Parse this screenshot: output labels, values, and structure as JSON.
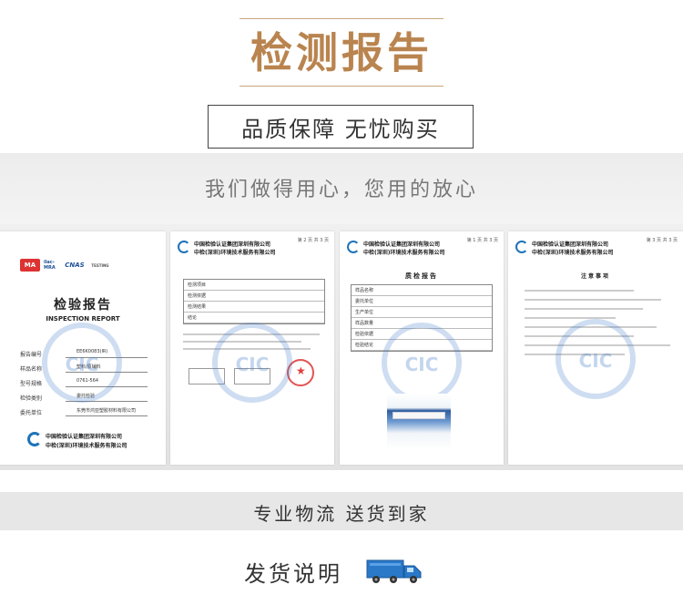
{
  "hero": {
    "title": "检测报告",
    "subtitle": "品质保障 无忧购买"
  },
  "slogan": "我们做得用心，您用的放心",
  "documents": {
    "doc1": {
      "badges": [
        "MA",
        "ilac-MRA",
        "CNAS",
        "TESTING"
      ],
      "report_title_cn": "检验报告",
      "report_title_en": "INSPECTION REPORT",
      "fields": [
        {
          "label": "报告编号",
          "value": "EE6K0083(IR)"
        },
        {
          "label": "样品名称",
          "value": "塑料/原辅料"
        },
        {
          "label": "型号规格",
          "value": "0761-564"
        },
        {
          "label": "检验类别",
          "value": "委托检验"
        },
        {
          "label": "委托单位",
          "value": "东莞市鸿亚塑胶材料有限公司"
        }
      ],
      "org_cn_1": "中国检验认证集团深圳有限公司",
      "org_cn_2": "中检(深圳)环境技术服务有限公司",
      "watermark": "CIC"
    },
    "doc2": {
      "page": "第 2 页 共 3 页",
      "org_cn_1": "中国检验认证集团深圳有限公司",
      "org_cn_2": "中检(深圳)环境技术服务有限公司",
      "table_rows": [
        "检测项目",
        "检测依据",
        "检测结果",
        "结论"
      ],
      "watermark": "CIC"
    },
    "doc3": {
      "page": "第 1 页 共 3 页",
      "org_cn_1": "中国检验认证集团深圳有限公司",
      "org_cn_2": "中检(深圳)环境技术服务有限公司",
      "heading": "质检报告",
      "table_rows": [
        "样品名称",
        "委托单位",
        "生产单位",
        "样品数量",
        "检验依据",
        "检验结论"
      ],
      "watermark": "CIC"
    },
    "doc4": {
      "page": "第 3 页 共 3 页",
      "org_cn_1": "中国检验认证集团深圳有限公司",
      "org_cn_2": "中检(深圳)环境技术服务有限公司",
      "heading": "注意事项",
      "watermark": "CIC"
    }
  },
  "logistics": "专业物流 送货到家",
  "shipping": {
    "title": "发货说明",
    "icon": "truck-icon"
  },
  "colors": {
    "title_gold": "#b9844f",
    "rule_gold": "#c9a77e",
    "cic_blue": "#1e73b8",
    "stamp_red": "#dc2828"
  }
}
